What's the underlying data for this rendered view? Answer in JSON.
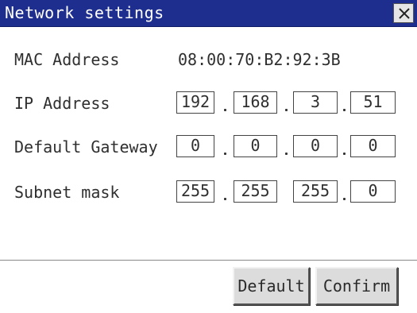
{
  "window": {
    "title": "Network settings",
    "close_icon": "close-icon",
    "colors": {
      "titlebar": "#1e2e8e",
      "title_text": "#ffffff",
      "background": "#ffffff"
    }
  },
  "mac": {
    "label": "MAC Address",
    "value": "08:00:70:B2:92:3B"
  },
  "ip": {
    "label": "IP Address",
    "octets": [
      "192",
      "168",
      "3",
      "51"
    ]
  },
  "gateway": {
    "label": "Default Gateway",
    "octets": [
      "0",
      "0",
      "0",
      "0"
    ]
  },
  "subnet": {
    "label": "Subnet mask",
    "octets": [
      "255",
      "255",
      "255",
      "0"
    ]
  },
  "buttons": {
    "default_label": "Default",
    "confirm_label": "Confirm"
  }
}
